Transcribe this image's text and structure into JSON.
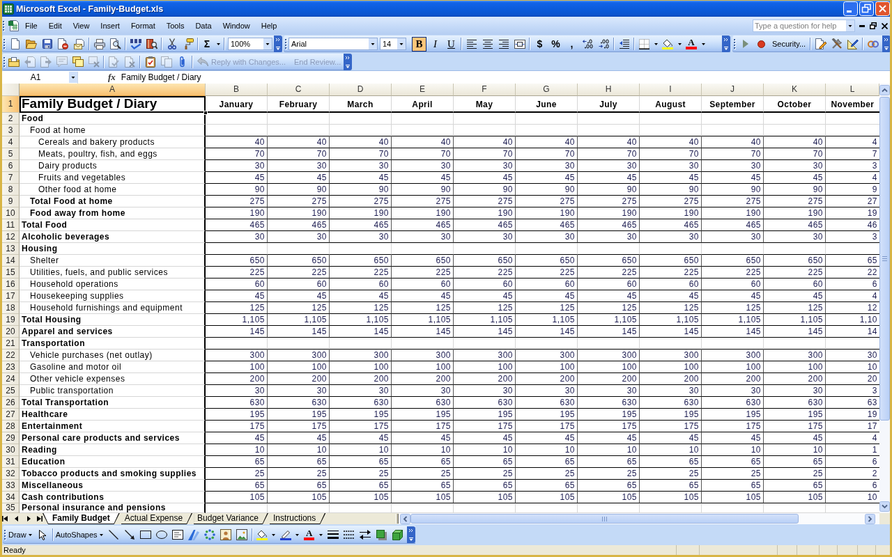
{
  "window": {
    "title": "Microsoft Excel - Family-Budget.xls"
  },
  "menu_bar": {
    "items": [
      "File",
      "Edit",
      "View",
      "Insert",
      "Format",
      "Tools",
      "Data",
      "Window",
      "Help"
    ],
    "help_search": {
      "placeholder": "Type a question for help"
    }
  },
  "standard_toolbar": {
    "autosum": "Σ",
    "zoom": "100%"
  },
  "formatting_toolbar": {
    "font": "Arial",
    "font_size": "14",
    "style_buttons": [
      {
        "label": "B",
        "selected": true
      },
      {
        "label": "I",
        "selected": false
      },
      {
        "label": "U",
        "selected": false
      }
    ],
    "number_buttons": [
      "$",
      "%",
      ","
    ],
    "font_color": "A"
  },
  "visual_basic_toolbar": {
    "security_button": "Security..."
  },
  "reviewing_toolbar": {
    "tools": [
      {
        "disabled": false
      },
      {
        "disabled": true
      },
      {
        "disabled": true
      },
      {
        "disabled": true
      },
      {
        "disabled": false
      },
      {
        "disabled": true
      },
      {
        "disabled": true
      },
      {
        "disabled": true
      },
      {
        "disabled": false
      },
      {
        "disabled": true
      },
      {
        "disabled": false
      }
    ],
    "buttons": [
      {
        "label": "Reply with Changes...",
        "disabled": true
      },
      {
        "label": "End Review...",
        "disabled": true
      }
    ]
  },
  "formula_bar": {
    "name_box": "A1",
    "function_button": "fx",
    "formula": "Family Budget / Diary"
  },
  "sheet": {
    "columns": [
      {
        "label": "A",
        "selected": true
      },
      {
        "label": "B",
        "selected": false
      },
      {
        "label": "C",
        "selected": false
      },
      {
        "label": "D",
        "selected": false
      },
      {
        "label": "E",
        "selected": false
      },
      {
        "label": "F",
        "selected": false
      },
      {
        "label": "G",
        "selected": false
      },
      {
        "label": "H",
        "selected": false
      },
      {
        "label": "I",
        "selected": false
      },
      {
        "label": "J",
        "selected": false
      },
      {
        "label": "K",
        "selected": false
      },
      {
        "label": "L",
        "selected": false
      }
    ],
    "header_row": {
      "number": "1",
      "selected": true,
      "title": "Family Budget / Diary",
      "months": [
        "January",
        "February",
        "March",
        "April",
        "May",
        "June",
        "July",
        "August",
        "September",
        "October",
        "November"
      ]
    },
    "rows": [
      {
        "number": "2",
        "selected": false,
        "label": "Food",
        "bold": true,
        "children": [
          {
            "number": "3",
            "selected": false,
            "label": "Food at home",
            "bold": false,
            "children": [
              {
                "number": "4",
                "selected": false,
                "label": "Cereals and bakery products",
                "bold": false,
                "values": [
                  "40",
                  "40",
                  "40",
                  "40",
                  "40",
                  "40",
                  "40",
                  "40",
                  "40",
                  "40",
                  "4"
                ]
              },
              {
                "number": "5",
                "selected": false,
                "label": "Meats, poultry, fish, and eggs",
                "bold": false,
                "values": [
                  "70",
                  "70",
                  "70",
                  "70",
                  "70",
                  "70",
                  "70",
                  "70",
                  "70",
                  "70",
                  "7"
                ]
              },
              {
                "number": "6",
                "selected": false,
                "label": "Dairy products",
                "bold": false,
                "values": [
                  "30",
                  "30",
                  "30",
                  "30",
                  "30",
                  "30",
                  "30",
                  "30",
                  "30",
                  "30",
                  "3"
                ]
              },
              {
                "number": "7",
                "selected": false,
                "label": "Fruits and vegetables",
                "bold": false,
                "values": [
                  "45",
                  "45",
                  "45",
                  "45",
                  "45",
                  "45",
                  "45",
                  "45",
                  "45",
                  "45",
                  "4"
                ]
              },
              {
                "number": "8",
                "selected": false,
                "label": "Other food at home",
                "bold": false,
                "values": [
                  "90",
                  "90",
                  "90",
                  "90",
                  "90",
                  "90",
                  "90",
                  "90",
                  "90",
                  "90",
                  "9"
                ]
              }
            ]
          },
          {
            "number": "9",
            "selected": false,
            "label": "Total Food at home",
            "bold": true,
            "values": [
              "275",
              "275",
              "275",
              "275",
              "275",
              "275",
              "275",
              "275",
              "275",
              "275",
              "27"
            ]
          },
          {
            "number": "10",
            "selected": false,
            "label": "Food away from home",
            "bold": true,
            "values": [
              "190",
              "190",
              "190",
              "190",
              "190",
              "190",
              "190",
              "190",
              "190",
              "190",
              "19"
            ]
          }
        ]
      },
      {
        "number": "11",
        "selected": false,
        "label": "Total Food",
        "bold": true,
        "values": [
          "465",
          "465",
          "465",
          "465",
          "465",
          "465",
          "465",
          "465",
          "465",
          "465",
          "46"
        ]
      },
      {
        "number": "12",
        "selected": false,
        "label": "Alcoholic beverages",
        "bold": true,
        "values": [
          "30",
          "30",
          "30",
          "30",
          "30",
          "30",
          "30",
          "30",
          "30",
          "30",
          "3"
        ]
      },
      {
        "number": "13",
        "selected": false,
        "label": "Housing",
        "bold": true,
        "children": [
          {
            "number": "14",
            "selected": false,
            "label": "Shelter",
            "bold": false,
            "values": [
              "650",
              "650",
              "650",
              "650",
              "650",
              "650",
              "650",
              "650",
              "650",
              "650",
              "65"
            ]
          },
          {
            "number": "15",
            "selected": false,
            "label": "Utilities, fuels, and public services",
            "bold": false,
            "values": [
              "225",
              "225",
              "225",
              "225",
              "225",
              "225",
              "225",
              "225",
              "225",
              "225",
              "22"
            ]
          },
          {
            "number": "16",
            "selected": false,
            "label": "Household operations",
            "bold": false,
            "values": [
              "60",
              "60",
              "60",
              "60",
              "60",
              "60",
              "60",
              "60",
              "60",
              "60",
              "6"
            ]
          },
          {
            "number": "17",
            "selected": false,
            "label": "Housekeeping supplies",
            "bold": false,
            "values": [
              "45",
              "45",
              "45",
              "45",
              "45",
              "45",
              "45",
              "45",
              "45",
              "45",
              "4"
            ]
          },
          {
            "number": "18",
            "selected": false,
            "label": "Household furnishings and equipment",
            "bold": false,
            "values": [
              "125",
              "125",
              "125",
              "125",
              "125",
              "125",
              "125",
              "125",
              "125",
              "125",
              "12"
            ]
          }
        ]
      },
      {
        "number": "19",
        "selected": false,
        "label": "Total Housing",
        "bold": true,
        "values": [
          "1,105",
          "1,105",
          "1,105",
          "1,105",
          "1,105",
          "1,105",
          "1,105",
          "1,105",
          "1,105",
          "1,105",
          "1,10"
        ]
      },
      {
        "number": "20",
        "selected": false,
        "label": "Apparel and services",
        "bold": true,
        "values": [
          "145",
          "145",
          "145",
          "145",
          "145",
          "145",
          "145",
          "145",
          "145",
          "145",
          "14"
        ]
      },
      {
        "number": "21",
        "selected": false,
        "label": "Transportation",
        "bold": true,
        "children": [
          {
            "number": "22",
            "selected": false,
            "label": "Vehicle purchases (net outlay)",
            "bold": false,
            "values": [
              "300",
              "300",
              "300",
              "300",
              "300",
              "300",
              "300",
              "300",
              "300",
              "300",
              "30"
            ]
          },
          {
            "number": "23",
            "selected": false,
            "label": "Gasoline and motor oil",
            "bold": false,
            "values": [
              "100",
              "100",
              "100",
              "100",
              "100",
              "100",
              "100",
              "100",
              "100",
              "100",
              "10"
            ]
          },
          {
            "number": "24",
            "selected": false,
            "label": "Other vehicle expenses",
            "bold": false,
            "values": [
              "200",
              "200",
              "200",
              "200",
              "200",
              "200",
              "200",
              "200",
              "200",
              "200",
              "20"
            ]
          },
          {
            "number": "25",
            "selected": false,
            "label": "Public transportation",
            "bold": false,
            "values": [
              "30",
              "30",
              "30",
              "30",
              "30",
              "30",
              "30",
              "30",
              "30",
              "30",
              "3"
            ]
          }
        ]
      },
      {
        "number": "26",
        "selected": false,
        "label": "Total Transportation",
        "bold": true,
        "values": [
          "630",
          "630",
          "630",
          "630",
          "630",
          "630",
          "630",
          "630",
          "630",
          "630",
          "63"
        ]
      },
      {
        "number": "27",
        "selected": false,
        "label": "Healthcare",
        "bold": true,
        "values": [
          "195",
          "195",
          "195",
          "195",
          "195",
          "195",
          "195",
          "195",
          "195",
          "195",
          "19"
        ]
      },
      {
        "number": "28",
        "selected": false,
        "label": "Entertainment",
        "bold": true,
        "values": [
          "175",
          "175",
          "175",
          "175",
          "175",
          "175",
          "175",
          "175",
          "175",
          "175",
          "17"
        ]
      },
      {
        "number": "29",
        "selected": false,
        "label": "Personal care products and services",
        "bold": true,
        "values": [
          "45",
          "45",
          "45",
          "45",
          "45",
          "45",
          "45",
          "45",
          "45",
          "45",
          "4"
        ]
      },
      {
        "number": "30",
        "selected": false,
        "label": "Reading",
        "bold": true,
        "values": [
          "10",
          "10",
          "10",
          "10",
          "10",
          "10",
          "10",
          "10",
          "10",
          "10",
          "1"
        ]
      },
      {
        "number": "31",
        "selected": false,
        "label": "Education",
        "bold": true,
        "values": [
          "65",
          "65",
          "65",
          "65",
          "65",
          "65",
          "65",
          "65",
          "65",
          "65",
          "6"
        ]
      },
      {
        "number": "32",
        "selected": false,
        "label": "Tobacco products and smoking supplies",
        "bold": true,
        "values": [
          "25",
          "25",
          "25",
          "25",
          "25",
          "25",
          "25",
          "25",
          "25",
          "25",
          "2"
        ]
      },
      {
        "number": "33",
        "selected": false,
        "label": "Miscellaneous",
        "bold": true,
        "values": [
          "65",
          "65",
          "65",
          "65",
          "65",
          "65",
          "65",
          "65",
          "65",
          "65",
          "6"
        ]
      },
      {
        "number": "34",
        "selected": false,
        "label": "Cash contributions",
        "bold": true,
        "values": [
          "105",
          "105",
          "105",
          "105",
          "105",
          "105",
          "105",
          "105",
          "105",
          "105",
          "10"
        ]
      },
      {
        "number": "35",
        "selected": false,
        "label": "Personal insurance and pensions",
        "bold": true
      }
    ]
  },
  "sheet_tabs": [
    {
      "label": "Family Budget",
      "selected": true
    },
    {
      "label": "Actual Expense",
      "selected": false
    },
    {
      "label": "Budget Variance",
      "selected": false
    },
    {
      "label": "Instructions",
      "selected": false
    }
  ],
  "drawing_toolbar": {
    "draw_menu": "Draw",
    "autoshapes_menu": "AutoShapes",
    "font_color": "A"
  },
  "status_bar": {
    "text": "Ready"
  }
}
